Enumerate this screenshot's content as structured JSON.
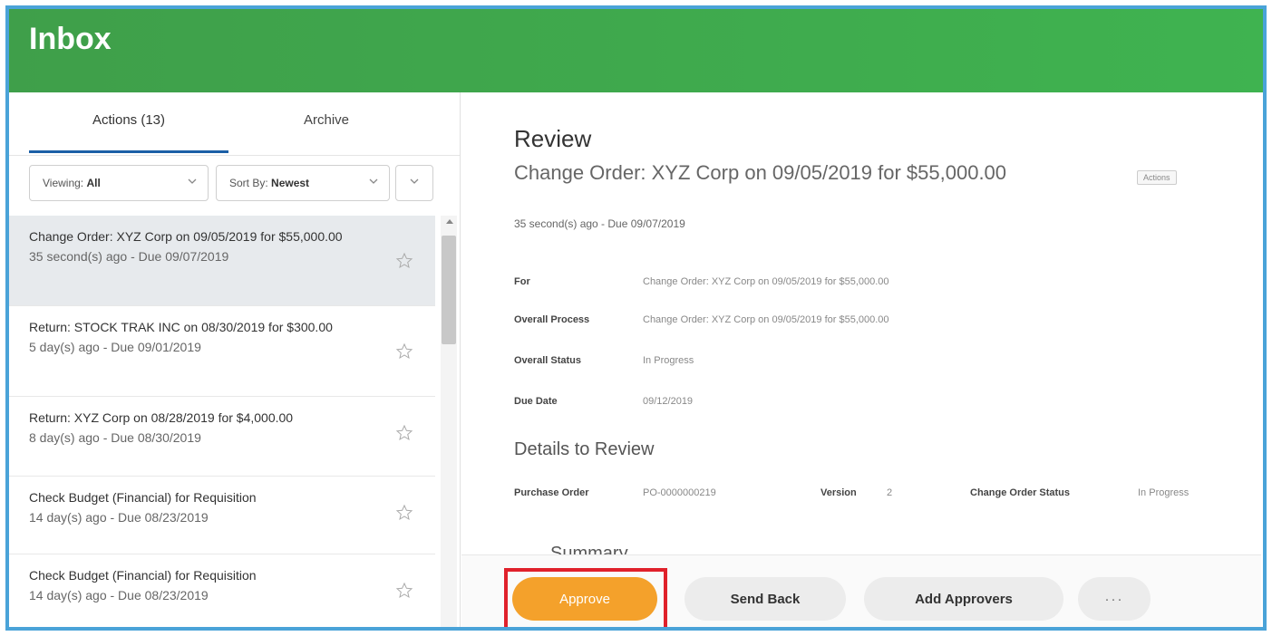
{
  "header": {
    "title": "Inbox"
  },
  "left": {
    "tabs": [
      {
        "label": "Actions (13)"
      },
      {
        "label": "Archive"
      }
    ],
    "filters": {
      "viewing_label": "Viewing:",
      "viewing_value": "All",
      "sort_label": "Sort By:",
      "sort_value": "Newest"
    },
    "items": [
      {
        "title": "Change Order: XYZ Corp on 09/05/2019 for $55,000.00",
        "meta": "35 second(s) ago - Due 09/07/2019",
        "selected": true
      },
      {
        "title": "Return: STOCK TRAK INC on 08/30/2019 for $300.00",
        "meta": "5 day(s) ago - Due 09/01/2019"
      },
      {
        "title": "Return: XYZ Corp on 08/28/2019 for $4,000.00",
        "meta": "8 day(s) ago - Due 08/30/2019"
      },
      {
        "title": "Check Budget (Financial) for Requisition",
        "meta": "14 day(s) ago - Due 08/23/2019"
      },
      {
        "title": "Check Budget (Financial) for Requisition",
        "meta": "14 day(s) ago - Due 08/23/2019"
      }
    ]
  },
  "right": {
    "title": "Review",
    "subtitle": "Change Order: XYZ Corp on 09/05/2019 for $55,000.00",
    "actions_badge": "Actions",
    "meta": "35 second(s) ago - Due 09/07/2019",
    "fields": [
      {
        "label": "For",
        "value": "Change Order: XYZ Corp on 09/05/2019 for $55,000.00"
      },
      {
        "label": "Overall Process",
        "value": "Change Order: XYZ Corp on 09/05/2019 for $55,000.00"
      },
      {
        "label": "Overall Status",
        "value": "In Progress"
      },
      {
        "label": "Due Date",
        "value": "09/12/2019"
      }
    ],
    "details_title": "Details to Review",
    "details": {
      "po_label": "Purchase Order",
      "po_value": "PO-0000000219",
      "version_label": "Version",
      "version_value": "2",
      "status_label": "Change Order Status",
      "status_value": "In Progress"
    },
    "summary_peek": "Summary",
    "buttons": {
      "approve": "Approve",
      "send_back": "Send Back",
      "add_approvers": "Add Approvers",
      "more": "···"
    }
  },
  "colors": {
    "header": "#3fb350",
    "approve": "#f4a12b",
    "highlight": "#e0212b",
    "tab_underline": "#1b5fa6",
    "frame_border": "#4aa3d8"
  }
}
